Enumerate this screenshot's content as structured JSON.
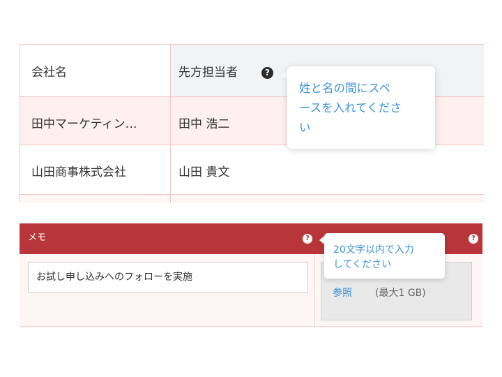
{
  "contacts_table": {
    "header": {
      "company": "会社名",
      "contact_person": "先方担当者"
    },
    "rows": [
      {
        "company": "田中マーケティン…",
        "contact_person": "田中 浩二"
      },
      {
        "company": "山田商事株式会社",
        "contact_person": "山田 貴文"
      }
    ],
    "help_icon": "question-circle-icon",
    "tooltip": "姓と名の間にスペースを入れてください",
    "tooltip_lines": [
      "姓と名の間にスペ",
      "ースを入れてくださ",
      "い"
    ]
  },
  "memo_panel": {
    "title": "メモ",
    "help_icon": "question-circle-icon",
    "help_glyph": "?",
    "input_value": "お試し申し込みへのフォローを実施",
    "tooltip_lines": [
      "20文字以内で入力",
      "してください"
    ],
    "browse_label": "参照",
    "max_size_label": "(最大1 GB)"
  },
  "colors": {
    "accent_red": "#b8363a",
    "link_blue": "#3d93d6",
    "row_highlight": "#fdf0ef",
    "header_gray": "#f2f3f5"
  }
}
